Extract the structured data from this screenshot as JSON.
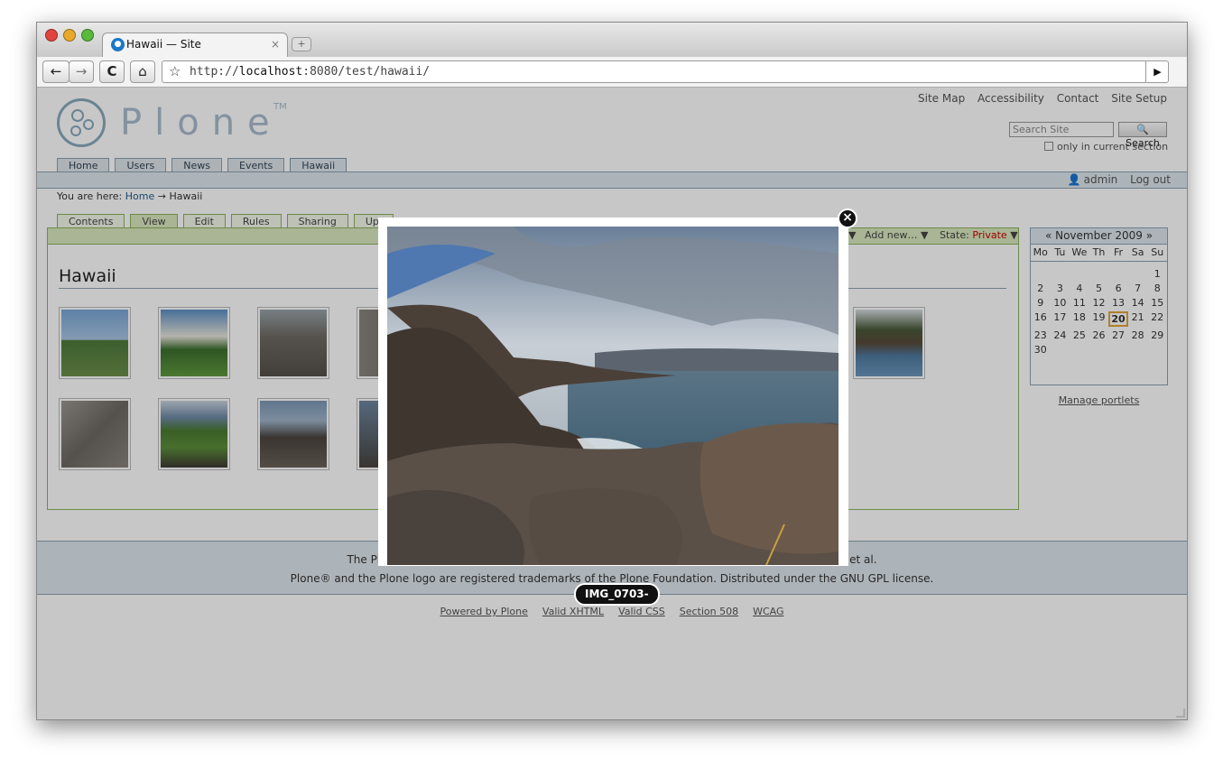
{
  "browser": {
    "tab_title": "Hawaii — Site",
    "tab_close": "×",
    "new_tab": "+",
    "url_scheme": "http://",
    "url_host": "localhost",
    "url_rest": ":8080/test/hawaii/",
    "back": "←",
    "forward": "→",
    "reload": "C",
    "home": "⌂",
    "star": "☆",
    "go": "▶"
  },
  "site_actions": [
    "Site Map",
    "Accessibility",
    "Contact",
    "Site Setup"
  ],
  "logo": {
    "word": "Plone",
    "tm": "TM"
  },
  "search": {
    "placeholder": "Search Site",
    "button": "Search",
    "only_section": "only in current section"
  },
  "global_nav": [
    "Home",
    "Users",
    "News",
    "Events",
    "Hawaii"
  ],
  "personal": {
    "user": "admin",
    "logout": "Log out"
  },
  "breadcrumbs": {
    "prefix": "You are here:",
    "home": "Home",
    "arrow": "→",
    "current": "Hawaii"
  },
  "content_tabs": [
    "Contents",
    "View",
    "Edit",
    "Rules",
    "Sharing",
    "Upl"
  ],
  "edit_bar": {
    "add_new": "Add new…",
    "state_label": "State:",
    "state_value": "Private",
    "arrow": "▼"
  },
  "page_title": "Hawaii",
  "calendar": {
    "header": "« November 2009 »",
    "weekdays": [
      "Mo",
      "Tu",
      "We",
      "Th",
      "Fr",
      "Sa",
      "Su"
    ],
    "days": [
      "",
      "",
      "",
      "",
      "",
      "",
      "1",
      "2",
      "3",
      "4",
      "5",
      "6",
      "7",
      "8",
      "9",
      "10",
      "11",
      "12",
      "13",
      "14",
      "15",
      "16",
      "17",
      "18",
      "19",
      "20",
      "21",
      "22",
      "23",
      "24",
      "25",
      "26",
      "27",
      "28",
      "29",
      "30",
      "",
      "",
      "",
      "",
      "",
      ""
    ],
    "today": "20"
  },
  "manage_portlets": "Manage portlets",
  "footer": {
    "line1_start": "The Pl",
    "line1_end": "et al.",
    "line2": "Plone® and the Plone logo are registered trademarks of the Plone Foundation. Distributed under the GNU GPL license."
  },
  "colophon": [
    "Powered by Plone",
    "Valid XHTML",
    "Valid CSS",
    "Section 508",
    "WCAG"
  ],
  "lightbox": {
    "caption": "IMG_0703-",
    "close": "×"
  }
}
